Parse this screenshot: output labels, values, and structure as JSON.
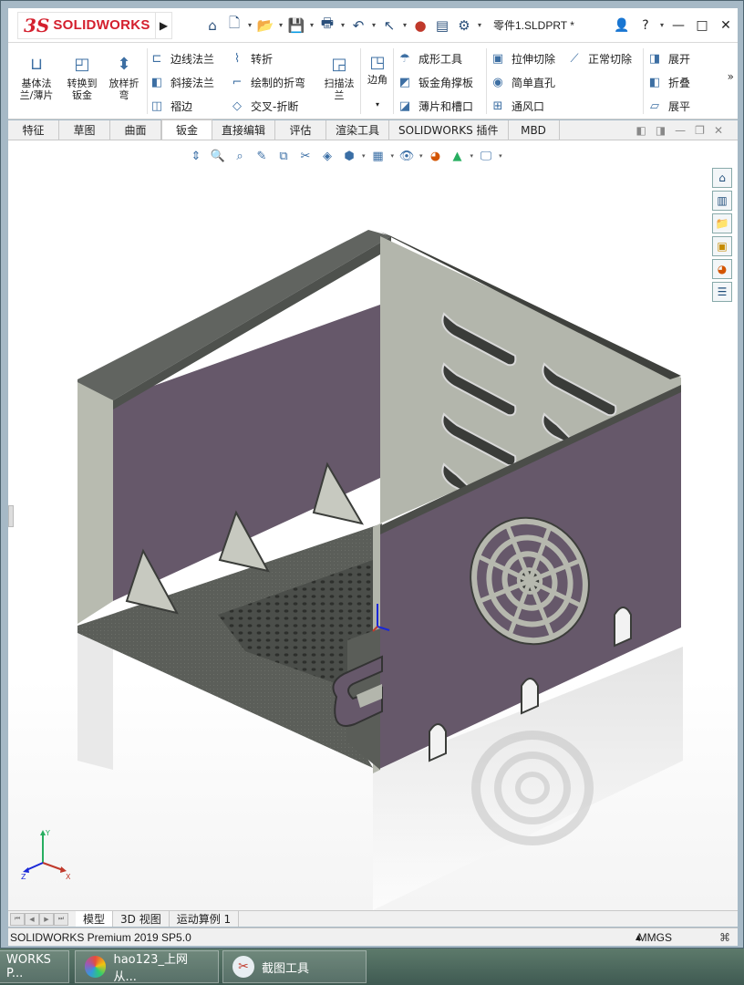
{
  "app": {
    "logo_ds": "3S",
    "logo_text": "SOLIDWORKS",
    "doc_title": "零件1.SLDPRT *"
  },
  "toolbar_icons": [
    "home-icon",
    "new-file-icon",
    "open-file-icon",
    "save-icon",
    "print-icon",
    "undo-icon",
    "select-icon",
    "rebuild-icon",
    "file-properties-icon",
    "options-icon"
  ],
  "window_controls": {
    "help": "?",
    "minimize": "—",
    "maximize": "□",
    "close": "✕"
  },
  "ribbon": {
    "big_buttons": [
      {
        "label": "基体法\n兰/薄片",
        "icon": "base-flange-icon"
      },
      {
        "label": "转换到\n钣金",
        "icon": "convert-sheetmetal-icon"
      },
      {
        "label": "放样折\n弯",
        "icon": "lofted-bend-icon"
      }
    ],
    "col1": [
      "边线法兰",
      "斜接法兰",
      "褶边"
    ],
    "col2": [
      "转折",
      "绘制的折弯",
      "交叉-折断"
    ],
    "sweep": "扫描法\n兰",
    "corner": "边角",
    "col3": [
      "成形工具",
      "钣金角撑板",
      "薄片和槽口"
    ],
    "col4": [
      "拉伸切除",
      "简单直孔",
      "通风口"
    ],
    "col5": [
      "正常切除"
    ],
    "col6": [
      "展开",
      "折叠",
      "展平"
    ],
    "more": "»"
  },
  "tabs": [
    {
      "label": "特征",
      "active": false
    },
    {
      "label": "草图",
      "active": false
    },
    {
      "label": "曲面",
      "active": false
    },
    {
      "label": "钣金",
      "active": true
    },
    {
      "label": "直接编辑",
      "active": false
    },
    {
      "label": "评估",
      "active": false
    },
    {
      "label": "渲染工具",
      "active": false
    },
    {
      "label": "SOLIDWORKS 插件",
      "active": false
    },
    {
      "label": "MBD",
      "active": false
    }
  ],
  "bottom_tabs": [
    {
      "label": "模型",
      "active": true
    },
    {
      "label": "3D 视图",
      "active": false
    },
    {
      "label": "运动算例 1",
      "active": false
    }
  ],
  "status": {
    "text": "SOLIDWORKS Premium 2019 SP5.0",
    "units": "MMGS"
  },
  "taskbar": [
    {
      "label": "WORKS P..."
    },
    {
      "label": "hao123_上网从..."
    },
    {
      "label": "截图工具"
    }
  ],
  "colors": {
    "sheet_metal_face": "#66586a",
    "sheet_metal_light": "#b3b6ac",
    "sheet_metal_dark": "#5a5d58",
    "brand_red": "#d4202e"
  }
}
